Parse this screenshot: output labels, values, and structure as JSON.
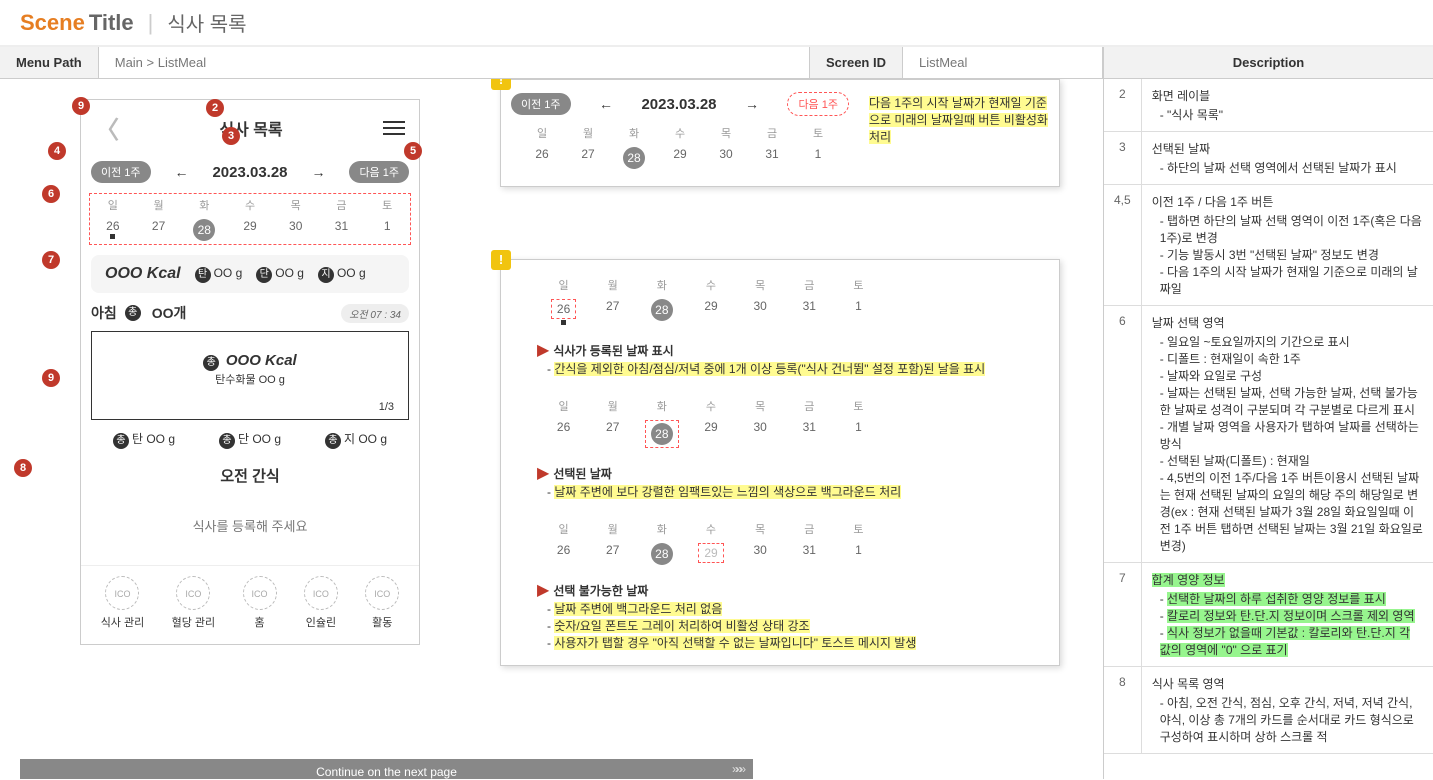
{
  "header": {
    "scene": "Scene",
    "titleWord": "Title",
    "sep": "|",
    "pageTitle": "식사 목록"
  },
  "meta": {
    "menuPathLabel": "Menu Path",
    "menuPathValue": "Main > ListMeal",
    "screenIdLabel": "Screen ID",
    "screenIdValue": "ListMeal",
    "descHead": "Description"
  },
  "phone": {
    "title": "식사 목록",
    "prevWeek": "이전 1주",
    "nextWeek": "다음 1주",
    "date": "2023.03.28",
    "dow": [
      "일",
      "월",
      "화",
      "수",
      "목",
      "금",
      "토"
    ],
    "days": [
      "26",
      "27",
      "28",
      "29",
      "30",
      "31",
      "1"
    ],
    "summary": {
      "kcal": "OOO Kcal",
      "c": "탄",
      "cval": "OO g",
      "p": "단",
      "pval": "OO g",
      "f": "지",
      "fval": "OO g"
    },
    "meal": {
      "name": "아침",
      "count": "OO개",
      "time": "오전 07 : 34",
      "kcal": "OOO Kcal",
      "sub": "탄수화물 OO g",
      "pg": "1/3"
    },
    "macro": {
      "a": "탄",
      "av": "OO g",
      "b": "단",
      "bv": "OO g",
      "c": "지",
      "cv": "OO g"
    },
    "snack": "오전 간식",
    "prompt": "식사를 등록해 주세요",
    "nav": [
      "식사 관리",
      "혈당 관리",
      "홈",
      "인슐린",
      "활동"
    ],
    "ico": "ICO"
  },
  "callout1": {
    "note": "다음 1주의 시작 날짜가 현재일 기준으로 미래의 날짜일때 버튼 비활성화 처리"
  },
  "callout2": {
    "sec1": {
      "title": "식사가 등록된 날짜 표시",
      "body": "간식을 제외한 아침/점심/저녁 중에 1개 이상 등록(\"식사 건너뜀\" 설정 포함)된 날을 표시"
    },
    "sec2": {
      "title": "선택된 날짜",
      "body": "날짜 주변에 보다 강렬한 임팩트있는 느낌의 색상으로 백그라운드 처리"
    },
    "sec3": {
      "title": "선택 불가능한 날짜",
      "l1": "날짜 주변에 백그라운드 처리 없음",
      "l2": "숫자/요일 폰트도 그레이 처리하여 비활성 상태 강조",
      "l3": "사용자가 탭할 경우 \"아직 선택할 수 없는 날짜입니다\" 토스트 메시지 발생"
    }
  },
  "desc": [
    {
      "n": "2",
      "title": "화면 레이블",
      "items": [
        "\"식사 목록\""
      ]
    },
    {
      "n": "3",
      "title": "선택된 날짜",
      "items": [
        "하단의 날짜 선택 영역에서 선택된 날짜가 표시"
      ]
    },
    {
      "n": "4,5",
      "title": "이전 1주 / 다음 1주 버튼",
      "items": [
        "탭하면 하단의 날짜 선택 영역이 이전 1주(혹은 다음 1주)로 변경",
        "기능 발동시 3번 \"선택된 날짜\" 정보도 변경",
        "다음 1주의 시작 날짜가 현재일 기준으로 미래의 날짜일"
      ]
    },
    {
      "n": "6",
      "title": "날짜 선택 영역",
      "items": [
        "일요일 ~토요일까지의 기간으로 표시",
        "디폴트 : 현재일이 속한 1주",
        "날짜와 요일로 구성",
        "날짜는 선택된 날짜, 선택 가능한 날짜, 선택 불가능한 날짜로 성격이 구분되며 각 구분별로 다르게 표시",
        "개별 날짜 영역을 사용자가 탭하여 날짜를 선택하는 방식",
        "선택된 날짜(디폴트) : 현재일",
        "4,5번의 이전 1주/다음 1주 버튼이용시 선택된 날짜는 현재 선택된 날짜의 요일의 해당 주의 해당일로 변경(ex : 현재 선택된 날짜가 3월 28일 화요일일때 이전 1주 버튼 탭하면 선택된 날짜는 3월 21일 화요일로 변경)"
      ]
    },
    {
      "n": "7",
      "title": "합계 영양 정보",
      "hl": true,
      "items": [
        "선택한 날짜의 하루 섭취한 영양 정보를 표시",
        "칼로리 정보와 탄.단.지 정보이며 스크롤 제외 영역",
        "식사 정보가 없을때 기본값 : 칼로리와 탄.단.지 각 값의 영역에 \"0\" 으로 표기"
      ]
    },
    {
      "n": "8",
      "title": "식사 목록 영역",
      "items": [
        "아침, 오전 간식, 점심, 오후 간식, 저녁, 저녁 간식, 야식, 이상 총 7개의 카드를 순서대로 카드 형식으로 구성하여 표시하며 상하 스크롤 적"
      ]
    }
  ],
  "continue": "Continue on the next page"
}
